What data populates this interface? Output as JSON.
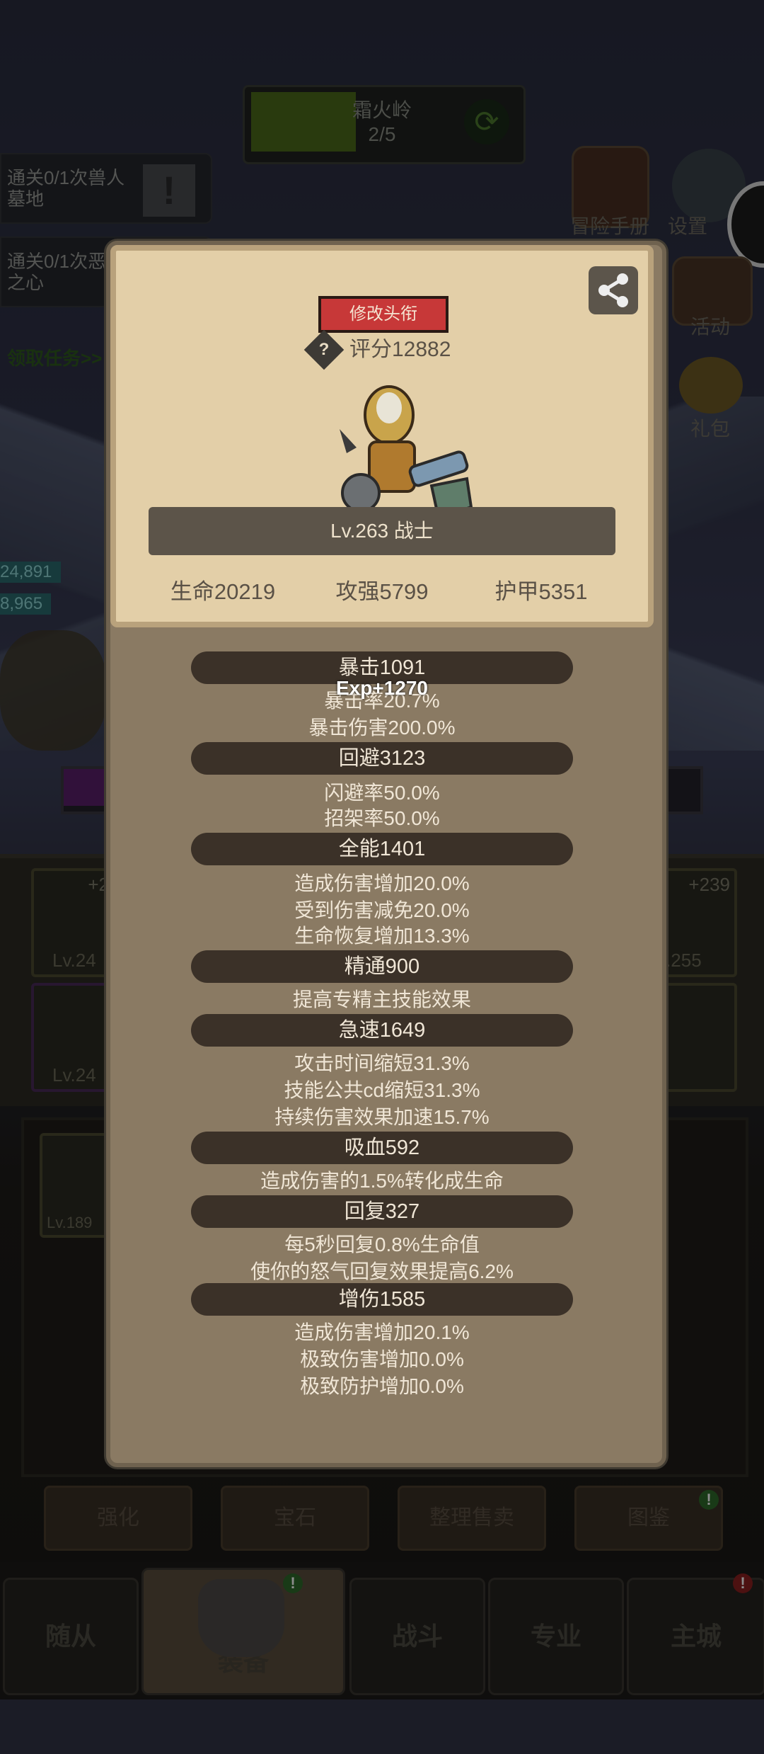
{
  "stage": {
    "name": "霜火岭",
    "progress_label": "2/5",
    "progress": 0.4
  },
  "quests": [
    {
      "text": "通关0/1次兽人墓地"
    },
    {
      "text": "通关0/1次恶魔之心"
    }
  ],
  "claim_quest": "领取任务>>",
  "side_menu": [
    {
      "label": "冒险手册",
      "icon": "book-icon"
    },
    {
      "label": "设置",
      "icon": "gear-icon"
    },
    {
      "label": "活动",
      "icon": "scroll-icon"
    },
    {
      "label": "礼包",
      "icon": "chest-icon"
    }
  ],
  "hp_bars": [
    "24,891",
    "8,965"
  ],
  "equipment_slots": [
    {
      "plus": "+2",
      "level": "Lv.24"
    },
    {
      "plus": "+239",
      "level": "v.255"
    },
    {
      "plus": "",
      "level": "Lv.24"
    },
    {
      "plus": "",
      "level": "Lv.189"
    }
  ],
  "bottom_buttons": [
    "强化",
    "宝石",
    "整理售卖",
    "图鉴"
  ],
  "nav": [
    "随从",
    "装备",
    "战斗",
    "专业",
    "主城"
  ],
  "profile": {
    "edit_title_button": "修改头衔",
    "rating": "评分12882",
    "level_class": "Lv.263 战士",
    "base_stats": [
      "生命20219",
      "攻强5799",
      "护甲5351"
    ],
    "exp_float": "Exp+1270",
    "stat_groups": [
      {
        "head": "暴击1091",
        "lines": [
          "暴击率20.7%",
          "暴击伤害200.0%"
        ]
      },
      {
        "head": "回避3123",
        "lines": [
          "闪避率50.0%",
          "招架率50.0%"
        ]
      },
      {
        "head": "全能1401",
        "lines": [
          "造成伤害增加20.0%",
          "受到伤害减免20.0%",
          "生命恢复增加13.3%"
        ]
      },
      {
        "head": "精通900",
        "lines": [
          "提高专精主技能效果"
        ]
      },
      {
        "head": "急速1649",
        "lines": [
          "攻击时间缩短31.3%",
          "技能公共cd缩短31.3%",
          "持续伤害效果加速15.7%"
        ]
      },
      {
        "head": "吸血592",
        "lines": [
          "造成伤害的1.5%转化成生命"
        ]
      },
      {
        "head": "回复327",
        "lines": [
          "每5秒回复0.8%生命值",
          "使你的怒气回复效果提高6.2%"
        ]
      },
      {
        "head": "增伤1585",
        "lines": [
          "造成伤害增加20.1%",
          "极致伤害增加0.0%",
          "极致防护增加0.0%"
        ]
      }
    ]
  },
  "colors": {
    "accent_red": "#c73838",
    "parchment": "#e3cfa8",
    "panel": "#8a7a63",
    "stat_pill": "#3b3128"
  }
}
